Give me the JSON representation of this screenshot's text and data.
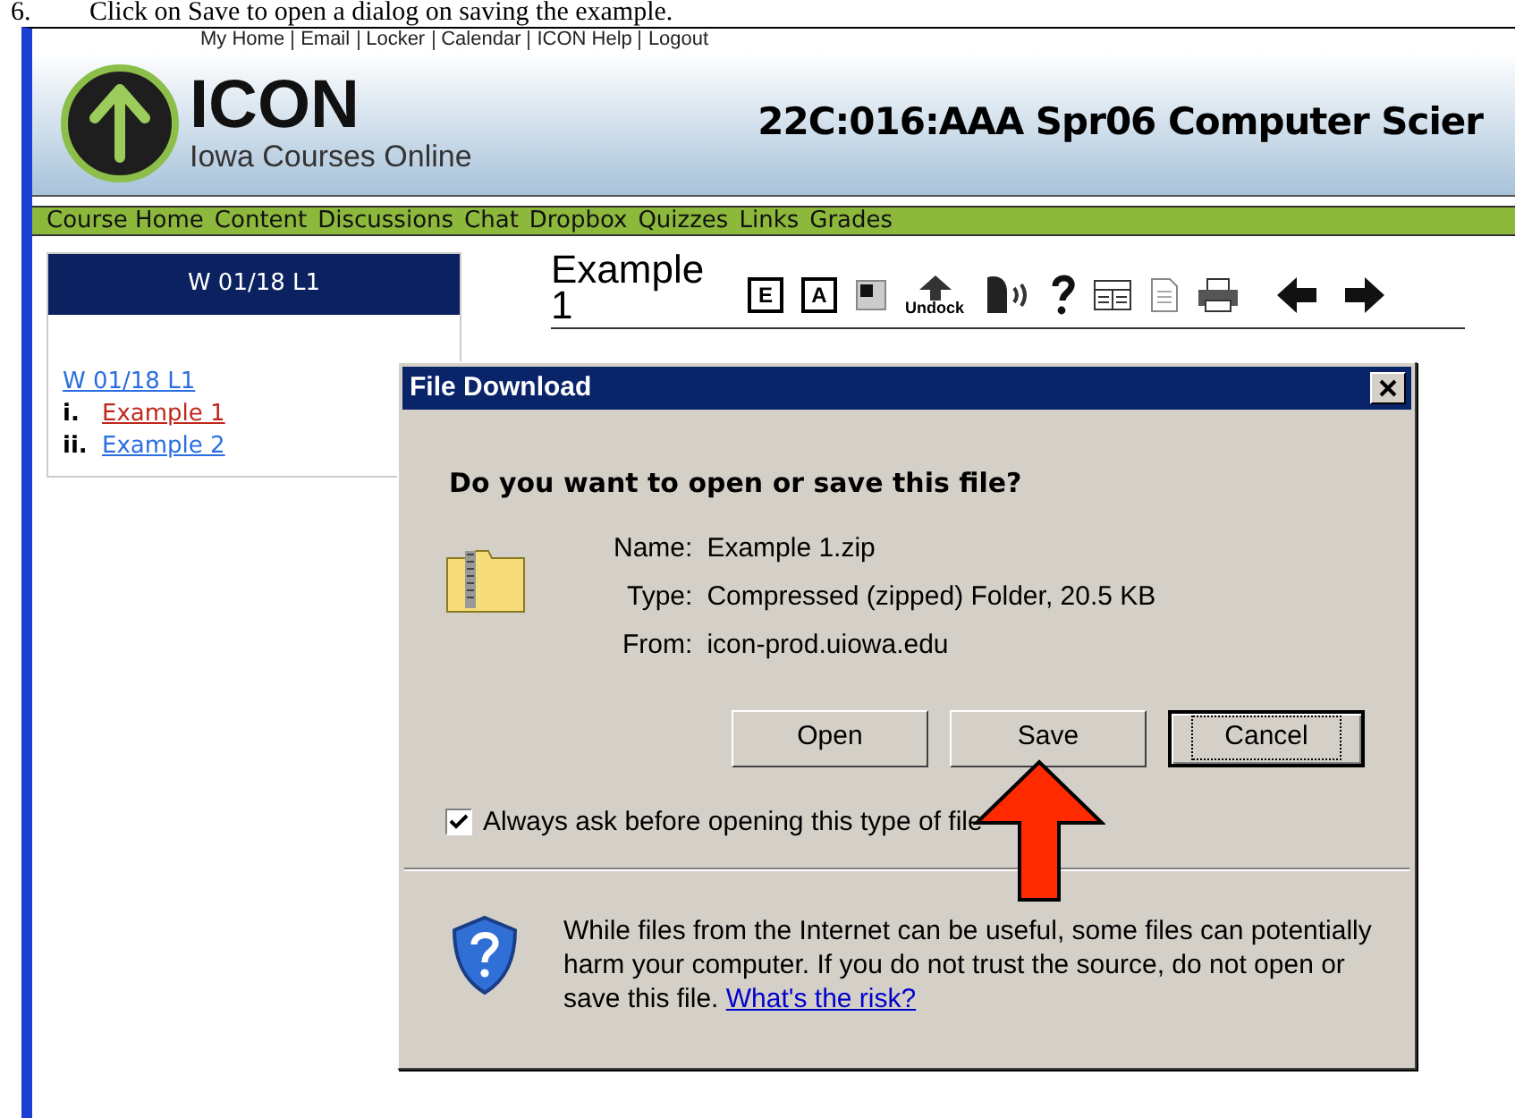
{
  "doc_step": {
    "number": "6.",
    "text": "Click on Save to open a dialog on saving the example."
  },
  "top_links": [
    "My Home",
    "Email",
    "Locker",
    "Calendar",
    "ICON Help",
    "Logout"
  ],
  "logo": {
    "title": "ICON",
    "subtitle": "Iowa Courses Online"
  },
  "course_title": "22C:016:AAA Spr06 Computer Scier",
  "nav": [
    "Course Home",
    "Content",
    "Discussions",
    "Chat",
    "Dropbox",
    "Quizzes",
    "Links",
    "Grades"
  ],
  "sidebar": {
    "heading": "W 01/18 L1",
    "items": [
      {
        "label": "W 01/18 L1",
        "selected": false,
        "children": [
          {
            "marker": "i.",
            "label": "Example 1",
            "selected": true
          },
          {
            "marker": "ii.",
            "label": "Example 2",
            "selected": false
          }
        ]
      }
    ]
  },
  "content": {
    "title": "Example 1",
    "toolbar_letters": [
      "E",
      "A"
    ],
    "undock": "Undock"
  },
  "dialog": {
    "title": "File Download",
    "question": "Do you want to open or save this file?",
    "fields": [
      {
        "label": "Name:",
        "value": "Example 1.zip"
      },
      {
        "label": "Type:",
        "value": "Compressed (zipped) Folder, 20.5 KB"
      },
      {
        "label": "From:",
        "value": "icon-prod.uiowa.edu"
      }
    ],
    "buttons": [
      {
        "label": "Open",
        "focused": false
      },
      {
        "label": "Save",
        "focused": false
      },
      {
        "label": "Cancel",
        "focused": true
      }
    ],
    "checkbox": {
      "label": "Always ask before opening this type of file",
      "checked": true
    },
    "warning": {
      "text": "While files from the Internet can be useful, some files can potentially harm your computer. If you do not trust the source, do not open or save this file.",
      "link": "What's the risk?"
    }
  }
}
